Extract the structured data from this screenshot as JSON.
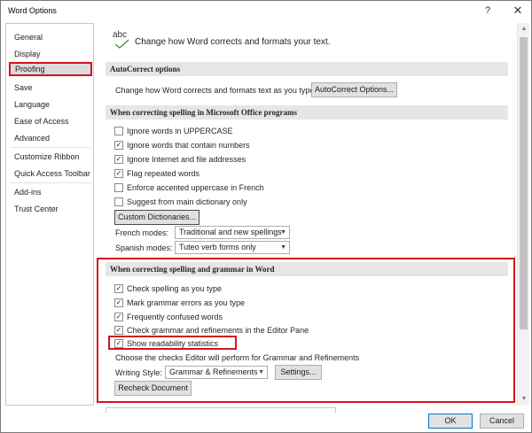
{
  "window": {
    "title": "Word Options",
    "help": "?",
    "close": "✕"
  },
  "sidebar": {
    "items": [
      "General",
      "Display",
      "Proofing",
      "Save",
      "Language",
      "Ease of Access",
      "Advanced",
      "Customize Ribbon",
      "Quick Access Toolbar",
      "Add-ins",
      "Trust Center"
    ],
    "selected": "Proofing"
  },
  "header": {
    "icon_text": "abc",
    "text": "Change how Word corrects and formats your text."
  },
  "autocorrect": {
    "title": "AutoCorrect options",
    "description": "Change how Word corrects and formats text as you type:",
    "button": "AutoCorrect Options..."
  },
  "office_spelling": {
    "title": "When correcting spelling in Microsoft Office programs",
    "options": [
      {
        "label": "Ignore words in UPPERCASE",
        "checked": false
      },
      {
        "label": "Ignore words that contain numbers",
        "checked": true
      },
      {
        "label": "Ignore Internet and file addresses",
        "checked": true
      },
      {
        "label": "Flag repeated words",
        "checked": true
      },
      {
        "label": "Enforce accented uppercase in French",
        "checked": false
      },
      {
        "label": "Suggest from main dictionary only",
        "checked": false
      }
    ],
    "custom_dict_button": "Custom Dictionaries...",
    "french_label": "French modes:",
    "french_value": "Traditional and new spellings",
    "spanish_label": "Spanish modes:",
    "spanish_value": "Tuteo verb forms only"
  },
  "word_spelling": {
    "title": "When correcting spelling and grammar in Word",
    "options": [
      {
        "label": "Check spelling as you type",
        "checked": true
      },
      {
        "label": "Mark grammar errors as you type",
        "checked": true
      },
      {
        "label": "Frequently confused words",
        "checked": true
      },
      {
        "label": "Check grammar and refinements in the Editor Pane",
        "checked": true
      },
      {
        "label": "Show readability statistics",
        "checked": true
      }
    ],
    "choose_text": "Choose the checks Editor will perform for Grammar and Refinements",
    "writing_style_label": "Writing Style:",
    "writing_style_value": "Grammar & Refinements",
    "settings_button": "Settings...",
    "recheck_button": "Recheck Document"
  },
  "footer": {
    "ok": "OK",
    "cancel": "Cancel"
  },
  "colors": {
    "highlight": "#d4141c",
    "section_bg": "#e6e6e6",
    "ok_border": "#0078d7"
  }
}
